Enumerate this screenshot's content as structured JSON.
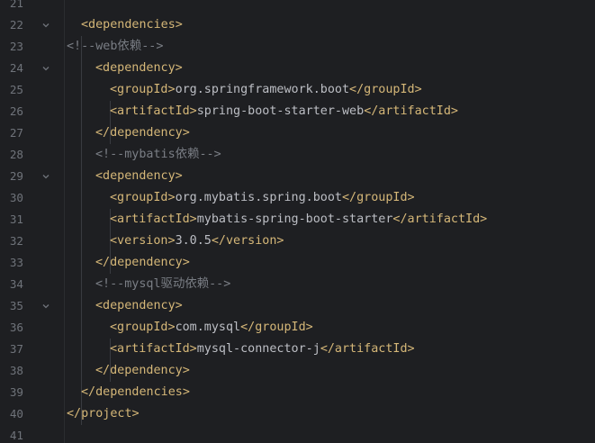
{
  "colors": {
    "background": "#1e1f22",
    "line_number": "#6f737a",
    "tag": "#d5b778",
    "text": "#bcbec4",
    "comment": "#7a7e85"
  },
  "lines": [
    {
      "num": "21",
      "fold": false,
      "indent": 0,
      "segments": []
    },
    {
      "num": "22",
      "fold": true,
      "indent": 1,
      "segments": [
        {
          "cls": "tag",
          "text": "<dependencies>"
        }
      ]
    },
    {
      "num": "23",
      "fold": false,
      "indent": 0,
      "segments": [
        {
          "cls": "cmt",
          "text": "<!--web依赖-->"
        }
      ]
    },
    {
      "num": "24",
      "fold": true,
      "indent": 2,
      "segments": [
        {
          "cls": "tag",
          "text": "<dependency>"
        }
      ]
    },
    {
      "num": "25",
      "fold": false,
      "indent": 3,
      "segments": [
        {
          "cls": "tag",
          "text": "<groupId>"
        },
        {
          "cls": "txt",
          "text": "org.springframework.boot"
        },
        {
          "cls": "tag",
          "text": "</groupId>"
        }
      ]
    },
    {
      "num": "26",
      "fold": false,
      "indent": 3,
      "segments": [
        {
          "cls": "tag",
          "text": "<artifactId>"
        },
        {
          "cls": "txt",
          "text": "spring-boot-starter-web"
        },
        {
          "cls": "tag",
          "text": "</artifactId>"
        }
      ]
    },
    {
      "num": "27",
      "fold": false,
      "indent": 2,
      "segments": [
        {
          "cls": "tag",
          "text": "</dependency>"
        }
      ]
    },
    {
      "num": "28",
      "fold": false,
      "indent": 2,
      "segments": [
        {
          "cls": "cmt",
          "text": "<!--mybatis依赖-->"
        }
      ]
    },
    {
      "num": "29",
      "fold": true,
      "indent": 2,
      "segments": [
        {
          "cls": "tag",
          "text": "<dependency>"
        }
      ]
    },
    {
      "num": "30",
      "fold": false,
      "indent": 3,
      "segments": [
        {
          "cls": "tag",
          "text": "<groupId>"
        },
        {
          "cls": "txt",
          "text": "org.mybatis.spring.boot"
        },
        {
          "cls": "tag",
          "text": "</groupId>"
        }
      ]
    },
    {
      "num": "31",
      "fold": false,
      "indent": 3,
      "segments": [
        {
          "cls": "tag",
          "text": "<artifactId>"
        },
        {
          "cls": "txt",
          "text": "mybatis-spring-boot-starter"
        },
        {
          "cls": "tag",
          "text": "</artifactId>"
        }
      ]
    },
    {
      "num": "32",
      "fold": false,
      "indent": 3,
      "segments": [
        {
          "cls": "tag",
          "text": "<version>"
        },
        {
          "cls": "txt",
          "text": "3.0.5"
        },
        {
          "cls": "tag",
          "text": "</version>"
        }
      ]
    },
    {
      "num": "33",
      "fold": false,
      "indent": 2,
      "segments": [
        {
          "cls": "tag",
          "text": "</dependency>"
        }
      ]
    },
    {
      "num": "34",
      "fold": false,
      "indent": 2,
      "segments": [
        {
          "cls": "cmt",
          "text": "<!--mysql驱动依赖-->"
        }
      ]
    },
    {
      "num": "35",
      "fold": true,
      "indent": 2,
      "segments": [
        {
          "cls": "tag",
          "text": "<dependency>"
        }
      ]
    },
    {
      "num": "36",
      "fold": false,
      "indent": 3,
      "segments": [
        {
          "cls": "tag",
          "text": "<groupId>"
        },
        {
          "cls": "txt",
          "text": "com.mysql"
        },
        {
          "cls": "tag",
          "text": "</groupId>"
        }
      ]
    },
    {
      "num": "37",
      "fold": false,
      "indent": 3,
      "segments": [
        {
          "cls": "tag",
          "text": "<artifactId>"
        },
        {
          "cls": "txt",
          "text": "mysql-connector-j"
        },
        {
          "cls": "tag",
          "text": "</artifactId>"
        }
      ]
    },
    {
      "num": "38",
      "fold": false,
      "indent": 2,
      "segments": [
        {
          "cls": "tag",
          "text": "</dependency>"
        }
      ]
    },
    {
      "num": "39",
      "fold": false,
      "indent": 1,
      "segments": [
        {
          "cls": "tag",
          "text": "</dependencies>"
        }
      ]
    },
    {
      "num": "40",
      "fold": false,
      "indent": 0,
      "segments": [
        {
          "cls": "tag",
          "text": "</project>"
        }
      ]
    },
    {
      "num": "41",
      "fold": false,
      "indent": 0,
      "segments": []
    }
  ]
}
